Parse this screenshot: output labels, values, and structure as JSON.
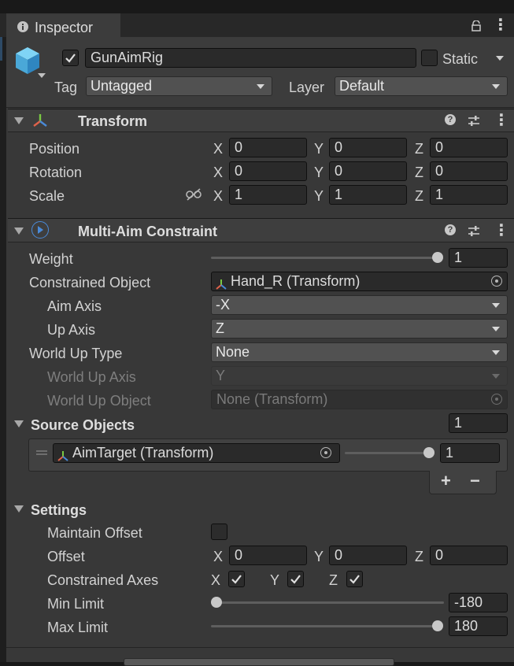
{
  "window": {
    "tab_title": "Inspector",
    "menu_glyph": "⋮"
  },
  "gameobject": {
    "active": true,
    "name": "GunAimRig",
    "static_label": "Static",
    "static_checked": false,
    "tag_label": "Tag",
    "tag_value": "Untagged",
    "layer_label": "Layer",
    "layer_value": "Default"
  },
  "transform": {
    "title": "Transform",
    "rows": [
      {
        "label": "Position",
        "x": "0",
        "y": "0",
        "z": "0"
      },
      {
        "label": "Rotation",
        "x": "0",
        "y": "0",
        "z": "0"
      },
      {
        "label": "Scale",
        "x": "1",
        "y": "1",
        "z": "1"
      }
    ]
  },
  "axis_labels": {
    "x": "X",
    "y": "Y",
    "z": "Z"
  },
  "multi_aim": {
    "title": "Multi-Aim Constraint",
    "weight_label": "Weight",
    "weight_value": "1",
    "weight_fraction": 1.0,
    "constrained_object_label": "Constrained Object",
    "constrained_object_value": "Hand_R (Transform)",
    "aim_axis_label": "Aim Axis",
    "aim_axis_value": "-X",
    "up_axis_label": "Up Axis",
    "up_axis_value": "Z",
    "world_up_type_label": "World Up Type",
    "world_up_type_value": "None",
    "world_up_axis_label": "World Up Axis",
    "world_up_axis_value": "Y",
    "world_up_object_label": "World Up Object",
    "world_up_object_value": "None (Transform)"
  },
  "source_objects": {
    "title": "Source Objects",
    "count": "1",
    "items": [
      {
        "name": "AimTarget (Transform)",
        "weight": "1",
        "weight_fraction": 1.0
      }
    ],
    "add_glyph": "+",
    "remove_glyph": "−"
  },
  "settings": {
    "title": "Settings",
    "maintain_offset_label": "Maintain Offset",
    "maintain_offset_checked": false,
    "offset_label": "Offset",
    "offset_x": "0",
    "offset_y": "0",
    "offset_z": "0",
    "constrained_axes_label": "Constrained Axes",
    "constrained_x": true,
    "constrained_y": true,
    "constrained_z": true,
    "min_limit_label": "Min Limit",
    "min_limit_value": "-180",
    "min_limit_fraction": 0.0,
    "max_limit_label": "Max Limit",
    "max_limit_value": "180",
    "max_limit_fraction": 1.0
  },
  "colors": {
    "background": "#383838",
    "header": "#3e3e3e",
    "field": "#2a2a2a",
    "dropdown": "#515151",
    "accent_blue": "#4a8ad8"
  }
}
